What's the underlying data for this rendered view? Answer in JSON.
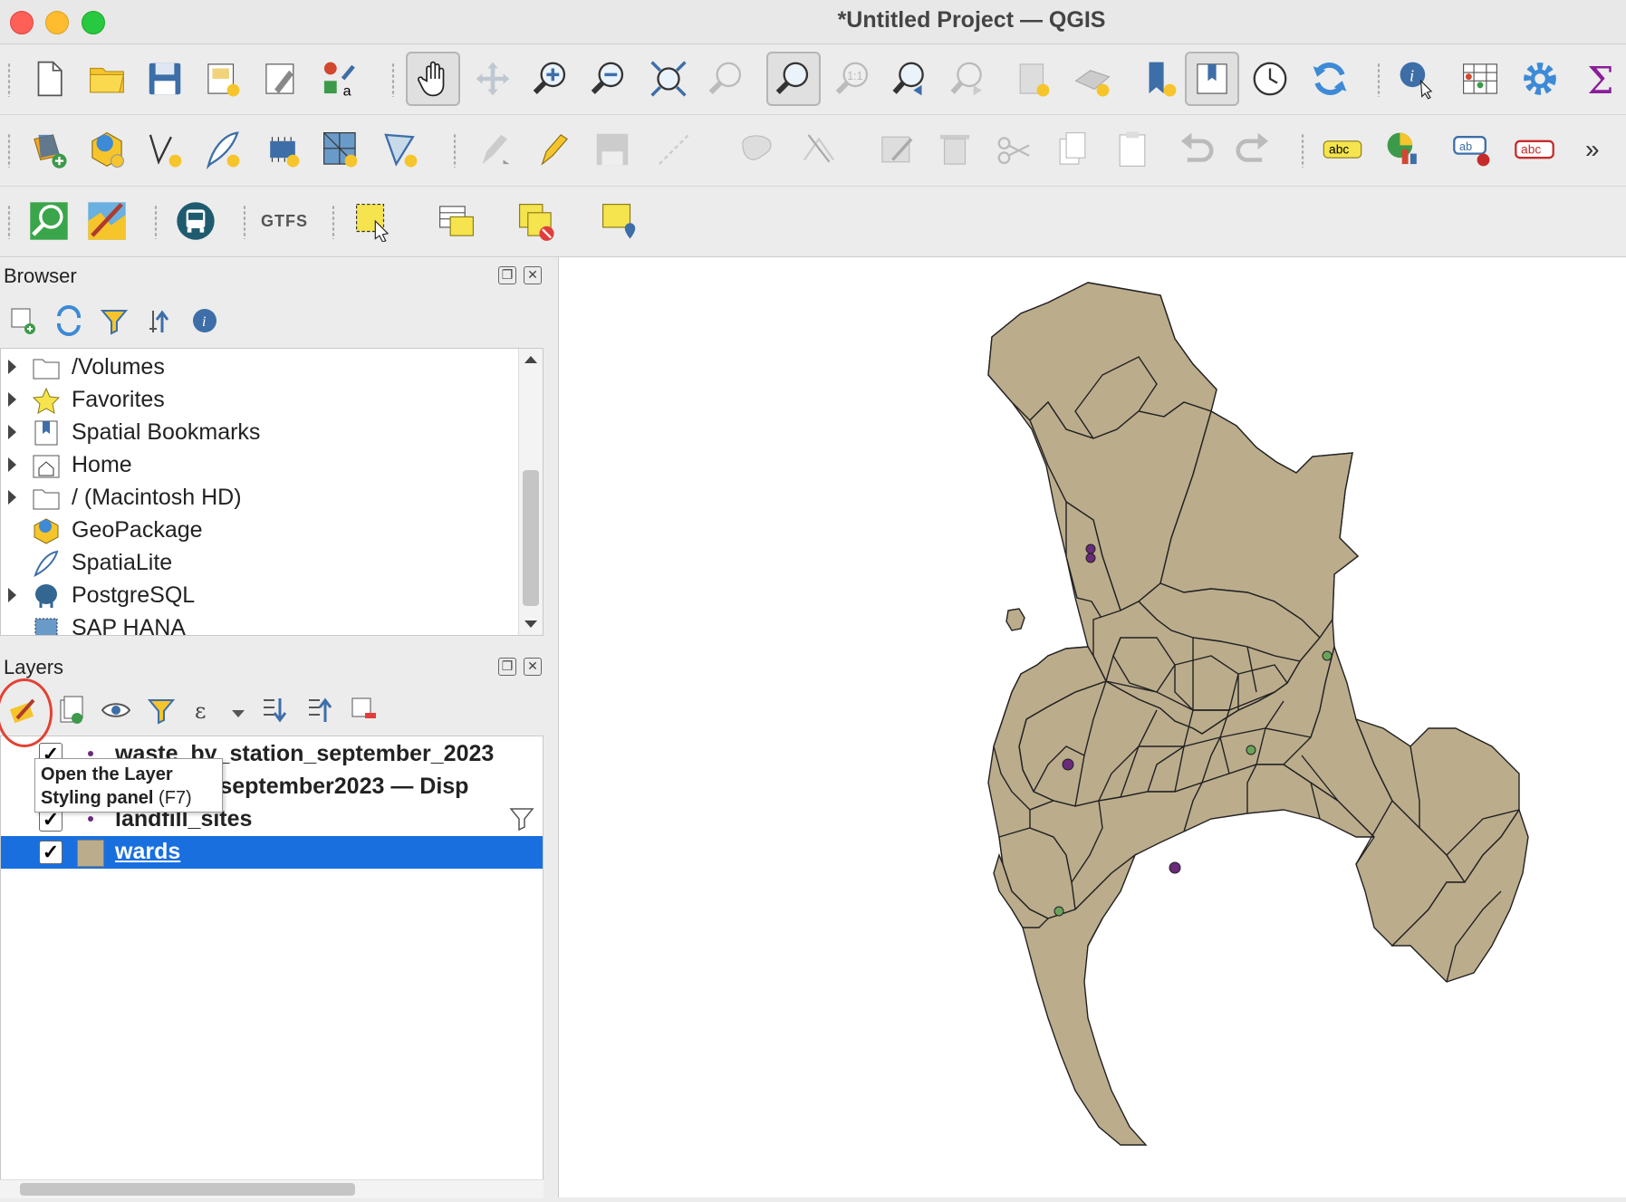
{
  "window": {
    "title": "*Untitled Project — QGIS"
  },
  "toolbar_more": "»",
  "gtfs_label": "GTFS",
  "browser": {
    "title": "Browser",
    "items": [
      {
        "label": "/Volumes",
        "expandable": true,
        "icon": "folder-icon"
      },
      {
        "label": "Favorites",
        "expandable": true,
        "icon": "star-icon"
      },
      {
        "label": "Spatial Bookmarks",
        "expandable": true,
        "icon": "bookmark-icon"
      },
      {
        "label": "Home",
        "expandable": true,
        "icon": "home-icon"
      },
      {
        "label": "/ (Macintosh HD)",
        "expandable": true,
        "icon": "folder-icon"
      },
      {
        "label": "GeoPackage",
        "expandable": false,
        "icon": "geopackage-icon"
      },
      {
        "label": "SpatiaLite",
        "expandable": false,
        "icon": "spatialite-icon"
      },
      {
        "label": "PostgreSQL",
        "expandable": true,
        "icon": "postgresql-icon"
      },
      {
        "label": "SAP HANA",
        "expandable": false,
        "icon": "sap-hana-icon"
      }
    ]
  },
  "layers": {
    "title": "Layers",
    "items": [
      {
        "label": "waste_by_station_september_2023",
        "type": "point",
        "checked": true,
        "selected": false
      },
      {
        "label": "disposal_september2023 — Disp",
        "type": "point",
        "checked": true,
        "selected": false
      },
      {
        "label": "landfill_sites",
        "type": "point",
        "checked": true,
        "selected": false,
        "filtered": true
      },
      {
        "label": "wards",
        "type": "polygon",
        "checked": true,
        "selected": true
      }
    ]
  },
  "tooltip": {
    "line1": "Open the Layer",
    "line2": "Styling panel",
    "shortcut": "(F7)"
  },
  "colors": {
    "polygon_fill": "#bbac8c",
    "selection": "#1a6fdf",
    "highlight": "#e34234",
    "point_purple": "#6a2a7a",
    "point_green": "#6aa25a"
  }
}
